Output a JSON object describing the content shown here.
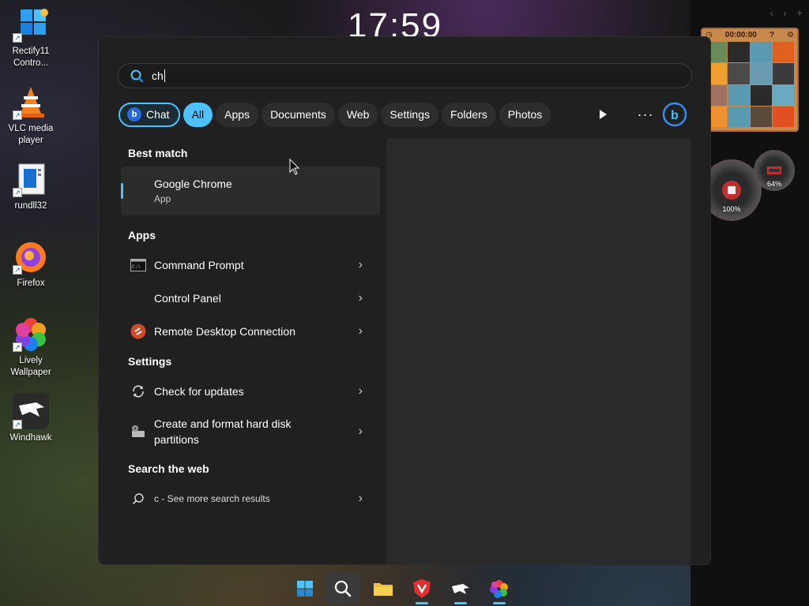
{
  "desktop": {
    "clock": "17:59",
    "icons": [
      {
        "label": "Rectify11 Contro...",
        "icon": "windows-logo"
      },
      {
        "label": "VLC media player",
        "icon": "vlc-cone"
      },
      {
        "label": "rundll32",
        "icon": "rundll-doc"
      },
      {
        "label": "Firefox",
        "icon": "firefox-logo"
      },
      {
        "label": "Lively Wallpaper",
        "icon": "lively-flower"
      },
      {
        "label": "Windhawk",
        "icon": "windhawk-eagle"
      }
    ]
  },
  "widgets": {
    "puzzle_timer": "00:00:00",
    "gauge_large": "100%",
    "gauge_small": "64%"
  },
  "search": {
    "query": "ch"
  },
  "filters": [
    {
      "label": "Chat"
    },
    {
      "label": "All"
    },
    {
      "label": "Apps"
    },
    {
      "label": "Documents"
    },
    {
      "label": "Web"
    },
    {
      "label": "Settings"
    },
    {
      "label": "Folders"
    },
    {
      "label": "Photos"
    }
  ],
  "results": {
    "best_match": {
      "header": "Best match",
      "name": "Google Chrome",
      "type": "App"
    },
    "apps": {
      "header": "Apps",
      "items": [
        {
          "label": "Command Prompt",
          "icon": "cmd-icon"
        },
        {
          "label": "Control Panel",
          "icon": "control-panel-icon"
        },
        {
          "label": "Remote Desktop Connection",
          "icon": "remote-desktop-icon"
        }
      ]
    },
    "settings": {
      "header": "Settings",
      "items": [
        {
          "label": "Check for updates",
          "icon": "sync-icon"
        },
        {
          "label": "Create and format hard disk partitions",
          "icon": "disk-management-icon"
        }
      ]
    },
    "web": {
      "header": "Search the web",
      "item": "c - See more search results"
    }
  },
  "colors": {
    "accent": "#4cc2ff",
    "menu_bg": "#202020",
    "preview_bg": "#2a2a2a"
  }
}
